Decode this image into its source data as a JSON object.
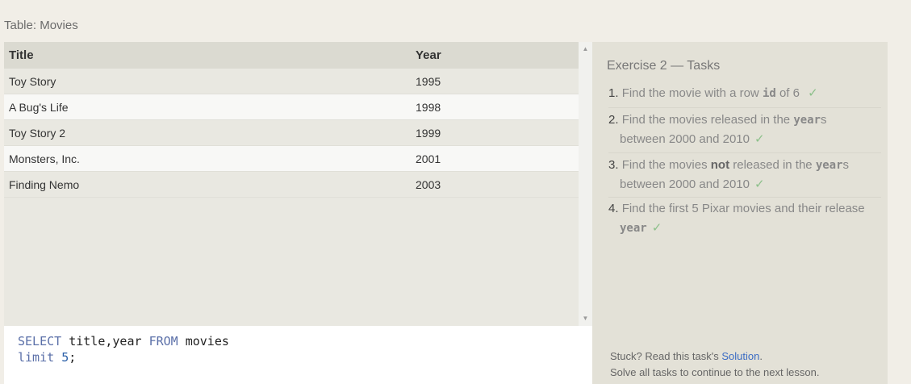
{
  "table": {
    "label": "Table: Movies",
    "headers": [
      "Title",
      "Year"
    ],
    "rows": [
      [
        "Toy Story",
        "1995"
      ],
      [
        "A Bug's Life",
        "1998"
      ],
      [
        "Toy Story 2",
        "1999"
      ],
      [
        "Monsters, Inc.",
        "2001"
      ],
      [
        "Finding Nemo",
        "2003"
      ]
    ]
  },
  "editor": {
    "line1": {
      "kw1": "SELECT",
      "mid": "title,year",
      "kw2": "FROM",
      "end": "movies"
    },
    "line2": {
      "kw": "limit",
      "num": "5",
      "end": ";"
    }
  },
  "tasks": {
    "title": "Exercise 2 — Tasks",
    "items": [
      {
        "num": "1.",
        "a": "Find the movie with a row",
        "code": "id",
        "b": "of 6",
        "check": "✓"
      },
      {
        "num": "2.",
        "a": "Find the movies released in the",
        "code": "year",
        "b": "s",
        "c": "between 2000 and 2010",
        "check": "✓"
      },
      {
        "num": "3.",
        "a": "Find the movies",
        "bold": "not",
        "a2": "released in the",
        "code": "year",
        "b": "s",
        "c": "between 2000 and 2010",
        "check": "✓"
      },
      {
        "num": "4.",
        "a": "Find the first 5 Pixar movies and their release",
        "code": "year",
        "check": "✓"
      }
    ],
    "footer": {
      "stuck_prefix": "Stuck? Read this task's",
      "solution_link": "Solution",
      "stuck_suffix": ".",
      "continue_text": "Solve all tasks to continue to the next lesson."
    }
  }
}
